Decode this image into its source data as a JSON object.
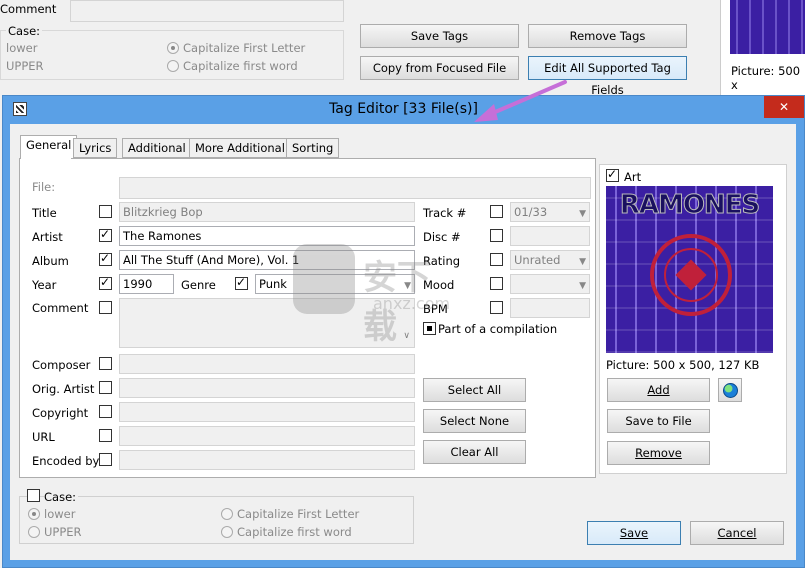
{
  "background": {
    "comment_label": "Comment",
    "case_label": "Case:",
    "lower": "lower",
    "upper": "UPPER",
    "cap_first_letter": "Capitalize First Letter",
    "cap_first_word": "Capitalize first word",
    "save_tags": "Save Tags",
    "remove_tags": "Remove Tags",
    "copy_from_focused": "Copy from Focused File",
    "edit_all": "Edit All Supported Tag Fields",
    "picture_info": "Picture: 500 x"
  },
  "dialog": {
    "title": "Tag Editor [33 File(s)]",
    "close": "✕",
    "tabs": [
      "General",
      "Lyrics",
      "Additional",
      "More Additional",
      "Sorting"
    ],
    "fields": {
      "file_label": "File:",
      "title_label": "Title",
      "title_value": "Blitzkrieg Bop",
      "artist_label": "Artist",
      "artist_value": "The Ramones",
      "album_label": "Album",
      "album_value": "All The Stuff (And More), Vol. 1",
      "year_label": "Year",
      "year_value": "1990",
      "genre_label": "Genre",
      "genre_value": "Punk",
      "comment_label": "Comment",
      "composer_label": "Composer",
      "orig_artist_label": "Orig. Artist",
      "copyright_label": "Copyright",
      "url_label": "URL",
      "encoded_by_label": "Encoded by",
      "track_label": "Track #",
      "track_value": "01/33",
      "disc_label": "Disc #",
      "rating_label": "Rating",
      "rating_value": "Unrated",
      "mood_label": "Mood",
      "bpm_label": "BPM",
      "compilation_label": "Part of a compilation"
    },
    "buttons": {
      "select_all": "Select All",
      "select_none": "Select None",
      "clear_all": "Clear All",
      "add": "Add",
      "save_to_file": "Save to File",
      "remove": "Remove",
      "save": "Save",
      "cancel": "Cancel"
    },
    "art": {
      "label": "Art",
      "band_name": "RAMONES",
      "picture_info": "Picture: 500 x 500, 127 KB"
    },
    "case": {
      "label": "Case:",
      "lower": "lower",
      "upper": "UPPER",
      "cap_first_letter": "Capitalize First Letter",
      "cap_first_word": "Capitalize first word"
    },
    "watermark": {
      "text_cn": "安下载",
      "text_url": "anxz.com"
    }
  },
  "colors": {
    "title_bar": "#5aa0e6",
    "close": "#c42b1c",
    "arrow": "#c66fd8",
    "art_bg": "#3b1fa3"
  }
}
